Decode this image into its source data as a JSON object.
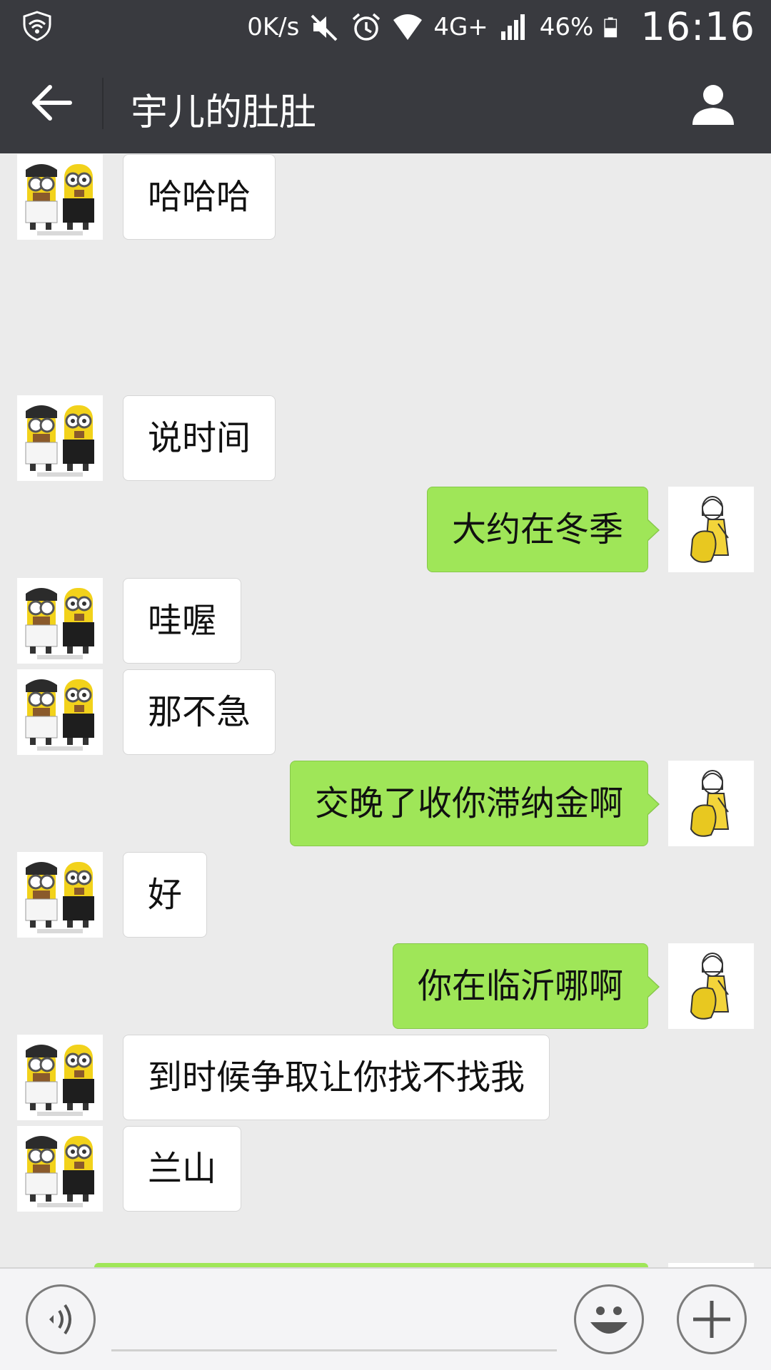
{
  "status_bar": {
    "net_speed": "0K/s",
    "network": "4G+",
    "battery": "46%",
    "time": "16:16"
  },
  "header": {
    "title": "宇儿的肚肚"
  },
  "messages": [
    {
      "side": "in",
      "text": "哈哈哈"
    },
    {
      "side": "in",
      "text": "说时间"
    },
    {
      "side": "out",
      "text": "大约在冬季"
    },
    {
      "side": "in",
      "text": "哇喔"
    },
    {
      "side": "in",
      "text": "那不急"
    },
    {
      "side": "out",
      "text": "交晚了收你滞纳金啊"
    },
    {
      "side": "in",
      "text": "好"
    },
    {
      "side": "out",
      "text": "你在临沂哪啊"
    },
    {
      "side": "in",
      "text": "到时候争取让你找不找我"
    },
    {
      "side": "in",
      "text": "兰山"
    }
  ],
  "input_bar": {
    "value": "",
    "icons": [
      "voice-icon",
      "emoji-icon",
      "plus-icon"
    ]
  },
  "colors": {
    "bar_bg": "#393a3f",
    "chat_bg": "#ebebeb",
    "out_bubble": "#9fe658",
    "in_bubble": "#ffffff"
  }
}
